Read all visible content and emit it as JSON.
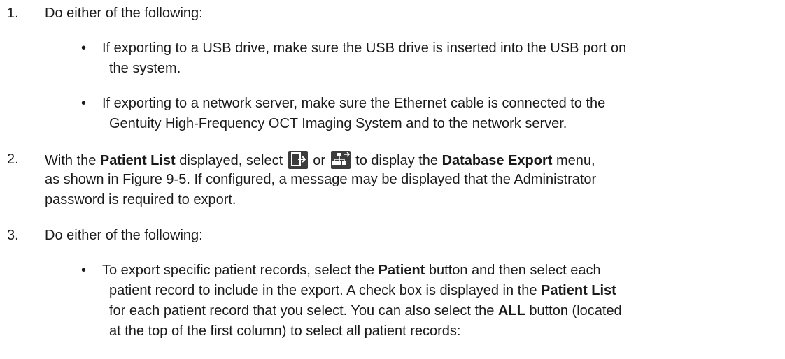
{
  "steps": [
    {
      "number": "1.",
      "text": "Do either of the following:",
      "bullets": [
        {
          "lines": [
            "If exporting to a USB drive, make sure the USB drive is inserted into the USB port on",
            "the system."
          ]
        },
        {
          "lines": [
            "If exporting to a network server, make sure the Ethernet cable is connected to the",
            "Gentuity High-Frequency OCT Imaging System and to the network server."
          ]
        }
      ]
    },
    {
      "number": "2.",
      "line1": {
        "a": "With the ",
        "b": "Patient List",
        "c": " displayed, select ",
        "d": " or ",
        "e": " to display the ",
        "f": "Database Export",
        "g": " menu,"
      },
      "line2": "as shown in Figure 9-5. If configured, a message may be displayed that the Administrator",
      "line3": "password is required to export.",
      "icons": [
        "export-file-icon",
        "network-export-icon"
      ]
    },
    {
      "number": "3.",
      "text": "Do either of the following:",
      "bullet": {
        "l1a": "To export specific patient records, select the ",
        "l1b": "Patient",
        "l1c": " button and then select each",
        "l2a": "patient record to include in the export. A check box is displayed in the ",
        "l2b": "Patient List",
        "l3": "for each patient record that you select. You can also select the ",
        "l3b": "ALL",
        "l3c": " button (located",
        "l4": "at the top of the first column) to select all patient records:"
      }
    }
  ]
}
